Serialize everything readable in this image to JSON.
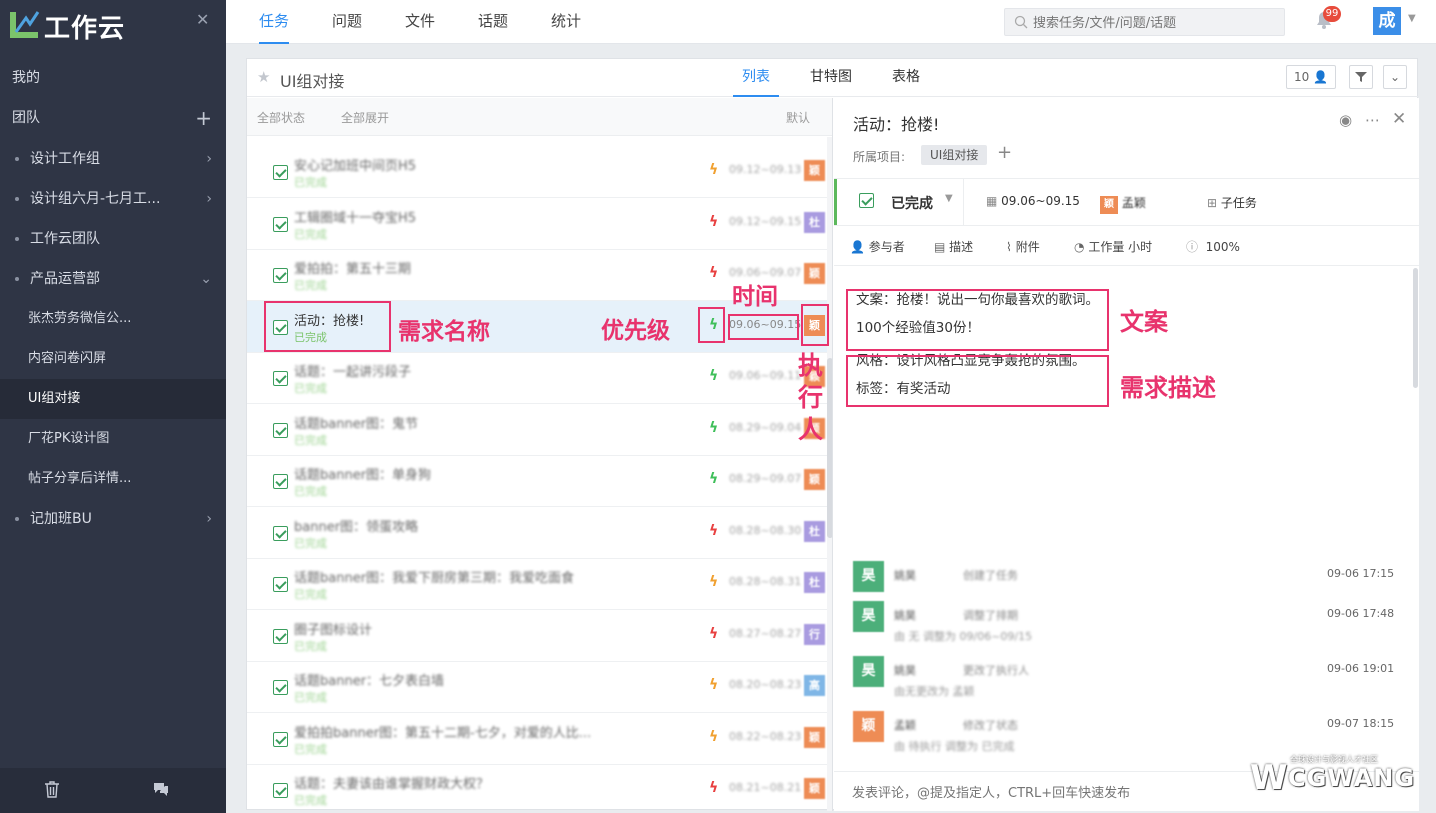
{
  "colors": {
    "accent": "#2d8cf0",
    "sidebar_bg": "#2f3545",
    "annotation": "#e8336d",
    "done_green": "#7bc46b"
  },
  "sidebar": {
    "logo_text": "工作云",
    "items": [
      {
        "label": "我的"
      },
      {
        "label": "团队"
      },
      {
        "label": "设计工作组"
      },
      {
        "label": "设计组六月-七月工..."
      },
      {
        "label": "工作云团队"
      },
      {
        "label": "产品运营部"
      },
      {
        "label": "张杰劳务微信公..."
      },
      {
        "label": "内容问卷闪屏"
      },
      {
        "label": "UI组对接"
      },
      {
        "label": "厂花PK设计图"
      },
      {
        "label": "帖子分享后详情..."
      },
      {
        "label": "记加班BU"
      }
    ]
  },
  "topnav": {
    "tabs": [
      "任务",
      "问题",
      "文件",
      "话题",
      "统计"
    ],
    "search_placeholder": "搜索任务/文件/问题/话题",
    "notif_count": "99",
    "user_avatar": "成"
  },
  "project": {
    "title": "UI组对接",
    "views": [
      "列表",
      "甘特图",
      "表格"
    ],
    "member_count": "10",
    "list_header": {
      "status": "全部状态",
      "expand": "全部展开",
      "sort": "默认"
    }
  },
  "tasks": [
    {
      "title": "安心记加班中间页H5",
      "status": "已完成",
      "date": "09.12~09.13",
      "priority_color": "#f0a030",
      "assignee": "颖",
      "av_color": "#ee8c55"
    },
    {
      "title": "工辑圈域十一夺宝H5",
      "status": "已完成",
      "date": "09.12~09.15",
      "priority_color": "#e84040",
      "assignee": "杜",
      "av_color": "#a99be0"
    },
    {
      "title": "爱拍拍：第五十三期",
      "status": "已完成",
      "date": "09.06~09.07",
      "priority_color": "#e84040",
      "assignee": "颖",
      "av_color": "#ee8c55"
    },
    {
      "title": "活动：抢楼!",
      "status": "已完成",
      "date": "09.06~09.15",
      "priority_color": "#3fbf5a",
      "assignee": "颖",
      "av_color": "#ee8c55"
    },
    {
      "title": "话题：一起讲污段子",
      "status": "已完成",
      "date": "09.06~09.11",
      "priority_color": "#3fbf5a",
      "assignee": "颖",
      "av_color": "#ee8c55"
    },
    {
      "title": "话题banner图：鬼节",
      "status": "已完成",
      "date": "08.29~09.04",
      "priority_color": "#3fbf5a",
      "assignee": "颖",
      "av_color": "#ee8c55"
    },
    {
      "title": "话题banner图：单身狗",
      "status": "已完成",
      "date": "08.29~09.07",
      "priority_color": "#3fbf5a",
      "assignee": "颖",
      "av_color": "#ee8c55"
    },
    {
      "title": "banner图：领蛋攻略",
      "status": "已完成",
      "date": "08.28~08.30",
      "priority_color": "#e84040",
      "assignee": "杜",
      "av_color": "#a99be0"
    },
    {
      "title": "话题banner图：我爱下厨房第三期：我爱吃面食",
      "status": "已完成",
      "date": "08.28~08.31",
      "priority_color": "#f0a030",
      "assignee": "杜",
      "av_color": "#a99be0"
    },
    {
      "title": "圈子图标设计",
      "status": "已完成",
      "date": "08.27~08.27",
      "priority_color": "#e84040",
      "assignee": "行",
      "av_color": "#a99be0"
    },
    {
      "title": "话题banner：七夕表白墙",
      "status": "已完成",
      "date": "08.20~08.23",
      "priority_color": "#f0a030",
      "assignee": "高",
      "av_color": "#7fb6e6"
    },
    {
      "title": "爱拍拍banner图：第五十二期-七夕，对爱的人比...",
      "status": "已完成",
      "date": "08.22~08.23",
      "priority_color": "#f0a030",
      "assignee": "颖",
      "av_color": "#ee8c55"
    },
    {
      "title": "话题：夫妻该由谁掌握财政大权？",
      "status": "已完成",
      "date": "08.21~08.21",
      "priority_color": "#e84040",
      "assignee": "颖",
      "av_color": "#ee8c55"
    }
  ],
  "detail": {
    "title": "活动：抢楼!",
    "project_label": "所属项目:",
    "project_tag": "UI组对接",
    "status": "已完成",
    "date_range": "09.06~09.15",
    "assignee": "孟颖",
    "assignee_initial": "颖",
    "subtask": "子任务",
    "tools": {
      "participants": "参与者",
      "description": "描述",
      "attachment": "附件",
      "workload": "工作量",
      "workload_unit": "小时",
      "progress": "100%"
    },
    "desc_lines": [
      "文案：抢楼！说出一句你最喜欢的歌词。",
      "100个经验值30份！",
      "风格：设计风格凸显竞争轰抢的氛围。",
      "标签：有奖活动"
    ],
    "activities": [
      {
        "initial": "昊",
        "name": "姚昊",
        "text": "创建了任务",
        "sub": "",
        "time": "09-06 17:15",
        "color": "#4caf7a"
      },
      {
        "initial": "昊",
        "name": "姚昊",
        "text": "调整了排期",
        "sub": "由 无 调整为 09/06~09/15",
        "time": "09-06 17:48",
        "color": "#4caf7a"
      },
      {
        "initial": "昊",
        "name": "姚昊",
        "text": "更改了执行人",
        "sub": "由无更改为 孟颖",
        "time": "09-06 19:01",
        "color": "#4caf7a"
      },
      {
        "initial": "颖",
        "name": "孟颖",
        "text": "修改了状态",
        "sub": "由 待执行 调整为 已完成",
        "time": "09-07 18:15",
        "color": "#ee8c55"
      }
    ],
    "comment_placeholder": "发表评论，@提及指定人，CTRL+回车快速发布"
  },
  "annotations": {
    "name": "需求名称",
    "priority": "优先级",
    "time": "时间",
    "assignee_chars": [
      "执",
      "行",
      "人"
    ],
    "copy": "文案",
    "desc": "需求描述"
  },
  "watermark": {
    "small": "全球设计与影视人才社区",
    "big": "CGWANG",
    "w": "W"
  }
}
